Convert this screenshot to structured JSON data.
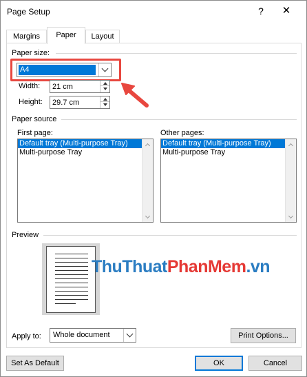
{
  "window": {
    "title": "Page Setup",
    "help_glyph": "?",
    "close_glyph": "✕"
  },
  "tabs": [
    {
      "label": "Margins",
      "active": false
    },
    {
      "label": "Paper",
      "active": true
    },
    {
      "label": "Layout",
      "active": false
    }
  ],
  "paper_size": {
    "section_label": "Paper size:",
    "selected": "A4",
    "width_label": "Width:",
    "width_value": "21 cm",
    "height_label": "Height:",
    "height_value": "29.7 cm"
  },
  "paper_source": {
    "section_label": "Paper source",
    "first_page": {
      "label": "First page:",
      "items": [
        "Default tray (Multi-purpose Tray)",
        "Multi-purpose Tray"
      ],
      "selected_index": 0
    },
    "other_pages": {
      "label": "Other pages:",
      "items": [
        "Default tray (Multi-purpose Tray)",
        "Multi-purpose Tray"
      ],
      "selected_index": 0
    }
  },
  "preview": {
    "section_label": "Preview"
  },
  "watermark": {
    "part1": "ThuThuat",
    "part2": "PhanMem",
    "part3": ".vn"
  },
  "apply": {
    "label": "Apply to:",
    "value": "Whole document"
  },
  "buttons": {
    "print_options": "Print Options...",
    "set_default": "Set As Default",
    "ok": "OK",
    "cancel": "Cancel"
  },
  "colors": {
    "highlight": "#e8473f",
    "selection": "#0078d7",
    "watermark_blue": "#2b7dc2",
    "watermark_red": "#e53935"
  }
}
